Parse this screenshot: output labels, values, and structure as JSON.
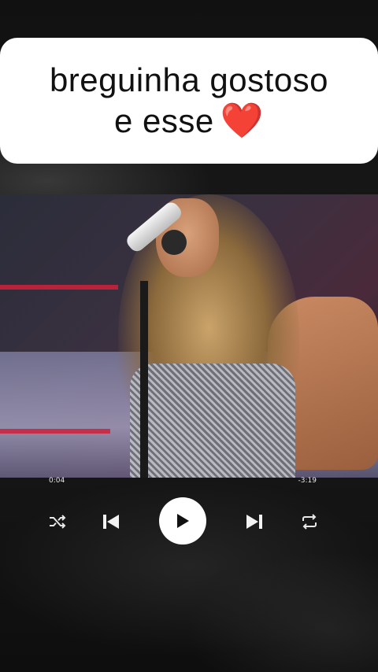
{
  "caption": {
    "line1": "breguinha gostoso",
    "line2": "e esse",
    "emoji": "❤️"
  },
  "player": {
    "current_time": "0:04",
    "total_time": "-3:19"
  },
  "icons": {
    "shuffle": "shuffle-icon",
    "previous": "skip-previous-icon",
    "play": "play-icon",
    "next": "skip-next-icon",
    "repeat": "repeat-icon"
  },
  "colors": {
    "heart": "#e0202a",
    "caption_bg": "#ffffff",
    "page_bg": "#0d0d0d"
  }
}
